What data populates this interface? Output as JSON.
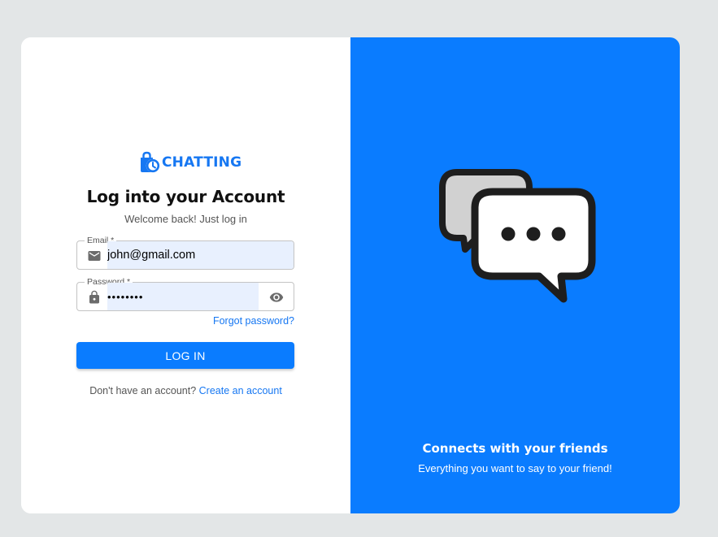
{
  "brand": {
    "name": "CHATTING",
    "icon": "bag-clock-icon",
    "color": "#1677f2"
  },
  "login": {
    "title": "Log into your Account",
    "subtitle": "Welcome back! Just log in",
    "email": {
      "label": "Email *",
      "value": "john@gmail.com",
      "icon": "mail-icon"
    },
    "password": {
      "label": "Password *",
      "value": "••••••••",
      "icon": "lock-icon",
      "toggle_icon": "eye-icon"
    },
    "forgot_label": "Forgot password?",
    "submit_label": "LOG IN",
    "signup_prompt": "Don't have an account?",
    "signup_link": "Create an account"
  },
  "promo": {
    "illustration": "chat-bubbles-icon",
    "title": "Connects with your friends",
    "subtitle": "Everything you want to say to your friend!"
  },
  "colors": {
    "primary": "#0a7cff",
    "page_background": "#e3e6e7",
    "autofill": "#e8f0fe"
  }
}
